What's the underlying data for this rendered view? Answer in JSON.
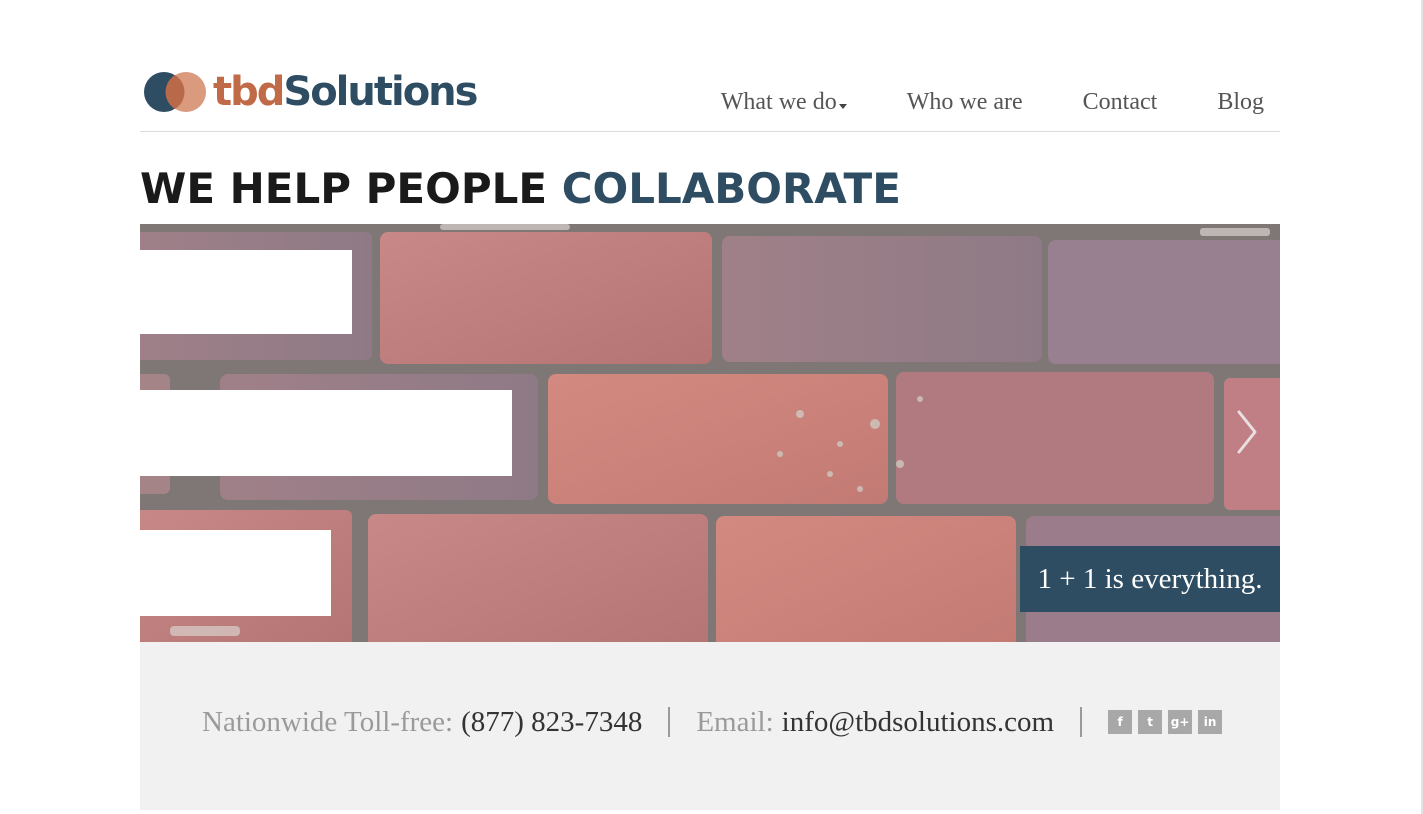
{
  "brand": {
    "name_part1": "tbd",
    "name_part2": "Solutions",
    "color_primary": "#2e4d63",
    "color_accent": "#c06a48"
  },
  "nav": {
    "items": [
      {
        "label": "What we do",
        "has_dropdown": true
      },
      {
        "label": "Who we are"
      },
      {
        "label": "Contact"
      },
      {
        "label": "Blog"
      }
    ]
  },
  "headline": {
    "part1": "WE HELP PEOPLE",
    "part2": "COLLABORATE"
  },
  "hero": {
    "caption": "1 + 1 is everything.",
    "next_icon": "chevron-right-icon"
  },
  "footer": {
    "phone_label": "Nationwide Toll-free:",
    "phone": "(877) 823-7348",
    "email_label": "Email:",
    "email": "info@tbdsolutions.com",
    "social": [
      {
        "icon": "facebook-icon",
        "glyph": "f"
      },
      {
        "icon": "twitter-icon",
        "glyph": "t"
      },
      {
        "icon": "google-plus-icon",
        "glyph": "g+"
      },
      {
        "icon": "linkedin-icon",
        "glyph": "in"
      }
    ]
  }
}
